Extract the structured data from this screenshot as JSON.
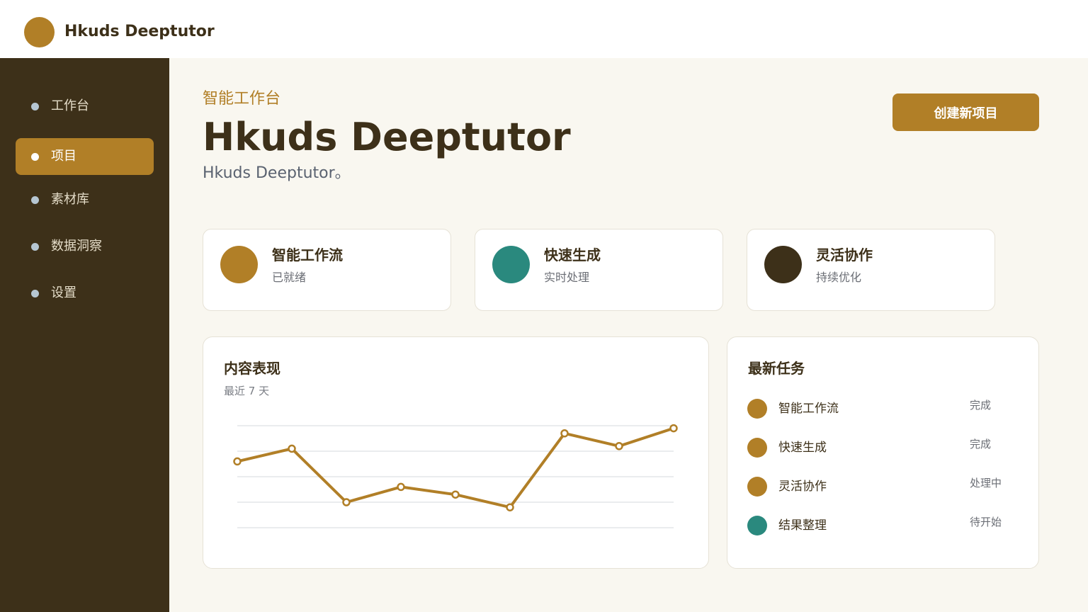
{
  "header": {
    "app_title": "Hkuds Deeptutor"
  },
  "sidebar": {
    "items": [
      {
        "label": "工作台",
        "active": false
      },
      {
        "label": "项目",
        "active": true
      },
      {
        "label": "素材库",
        "active": false
      },
      {
        "label": "数据洞察",
        "active": false
      },
      {
        "label": "设置",
        "active": false
      }
    ]
  },
  "hero": {
    "eyebrow": "智能工作台",
    "title": "Hkuds Deeptutor",
    "subtitle": "Hkuds Deeptutor。",
    "create_button": "创建新项目"
  },
  "stats": [
    {
      "title": "智能工作流",
      "subtitle": "已就绪",
      "color": "#b17f27",
      "icon": "circle-icon"
    },
    {
      "title": "快速生成",
      "subtitle": "实时处理",
      "color": "#2a897e",
      "icon": "circle-icon"
    },
    {
      "title": "灵活协作",
      "subtitle": "持续优化",
      "color": "#3d3019",
      "icon": "circle-icon"
    }
  ],
  "performance": {
    "title": "内容表现",
    "subtitle": "最近 7 天"
  },
  "chart_data": {
    "type": "line",
    "title": "内容表现",
    "subtitle": "最近 7 天",
    "x": [
      1,
      2,
      3,
      4,
      5,
      6,
      7,
      8,
      9
    ],
    "series": [
      {
        "values": [
          56,
          61,
          40,
          46,
          43,
          38,
          67,
          62,
          69
        ]
      }
    ],
    "ylim": [
      0,
      100
    ],
    "grid": true,
    "color": "#b17f27"
  },
  "tasks": {
    "title": "最新任务",
    "items": [
      {
        "name": "智能工作流",
        "status": "完成",
        "color": "#b17f27"
      },
      {
        "name": "快速生成",
        "status": "完成",
        "color": "#b17f27"
      },
      {
        "name": "灵活协作",
        "status": "处理中",
        "color": "#b17f27"
      },
      {
        "name": "结果整理",
        "status": "待开始",
        "color": "#2a897e"
      }
    ]
  }
}
